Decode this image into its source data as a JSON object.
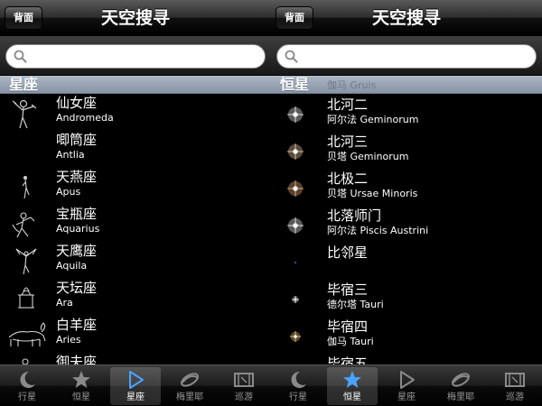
{
  "left": {
    "back_label": "背面",
    "title": "天空搜寻",
    "search_placeholder": "",
    "section_title": "星座",
    "rows": [
      {
        "zh": "仙女座",
        "en": "Andromeda",
        "icon": "andromeda-figure-icon"
      },
      {
        "zh": "唧筒座",
        "en": "Antlia",
        "icon": "antlia-figure-icon"
      },
      {
        "zh": "天燕座",
        "en": "Apus",
        "icon": "apus-figure-icon"
      },
      {
        "zh": "宝瓶座",
        "en": "Aquarius",
        "icon": "aquarius-figure-icon"
      },
      {
        "zh": "天鹰座",
        "en": "Aquila",
        "icon": "aquila-figure-icon"
      },
      {
        "zh": "天坛座",
        "en": "Ara",
        "icon": "ara-figure-icon"
      },
      {
        "zh": "白羊座",
        "en": "Aries",
        "icon": "aries-figure-icon"
      },
      {
        "zh": "御夫座",
        "en": "",
        "icon": "auriga-figure-icon"
      }
    ],
    "tabs": [
      {
        "label": "行星",
        "icon": "moon-icon"
      },
      {
        "label": "恒星",
        "icon": "star-icon"
      },
      {
        "label": "星座",
        "icon": "triangle-icon"
      },
      {
        "label": "梅里耶",
        "icon": "galaxy-icon"
      },
      {
        "label": "巡游",
        "icon": "film-icon"
      }
    ],
    "active_tab": 2
  },
  "right": {
    "back_label": "背面",
    "title": "天空搜寻",
    "search_placeholder": "",
    "section_title": "恒星",
    "section_overlay": "伽马 Gruis",
    "rows": [
      {
        "zh": "北河二",
        "en": "阿尔法 Geminorum",
        "color": "#ffffff",
        "size": "large"
      },
      {
        "zh": "北河三",
        "en": "贝塔 Geminorum",
        "color": "#ffd9b0",
        "size": "large"
      },
      {
        "zh": "北极二",
        "en": "贝塔 Ursae Minoris",
        "color": "#ffb98a",
        "size": "large"
      },
      {
        "zh": "北落师门",
        "en": "阿尔法 Piscis Austrini",
        "color": "#ffffff",
        "size": "large"
      },
      {
        "zh": "比邻星",
        "en": "",
        "color": "#5a4a8a",
        "size": "tiny"
      },
      {
        "zh": "毕宿三",
        "en": "德尔塔 Tauri",
        "color": "#ffffff",
        "size": "small"
      },
      {
        "zh": "毕宿四",
        "en": "伽马 Tauri",
        "color": "#ffd27a",
        "size": "medium"
      },
      {
        "zh": "毕宿五",
        "en": "",
        "color": "#ffb070",
        "size": "medium"
      }
    ],
    "tabs": [
      {
        "label": "行星",
        "icon": "moon-icon"
      },
      {
        "label": "恒星",
        "icon": "star-icon"
      },
      {
        "label": "星座",
        "icon": "triangle-icon"
      },
      {
        "label": "梅里耶",
        "icon": "galaxy-icon"
      },
      {
        "label": "巡游",
        "icon": "film-icon"
      }
    ],
    "active_tab": 1
  },
  "colors": {
    "active_tab_icon": "#4aa3ff",
    "inactive_tab_icon": "#8a8a8a"
  }
}
